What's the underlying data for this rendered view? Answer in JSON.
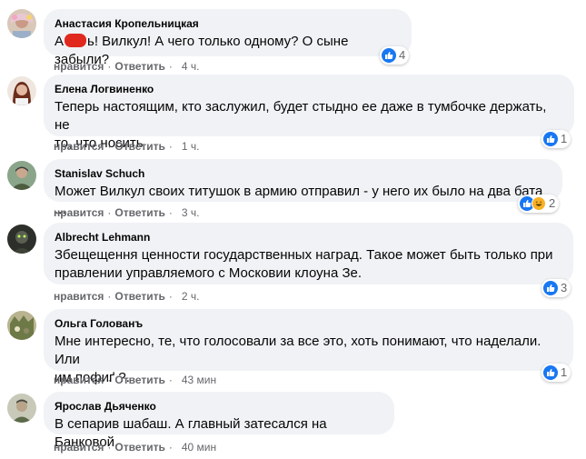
{
  "action_labels": {
    "like": "нравится",
    "reply": "Ответить",
    "separator": "·"
  },
  "comments": [
    {
      "author": "Анастасия Кропельницкая",
      "text_before": "А",
      "text_after": "ь! Вилкул! А чего только одному? О сыне забыли?",
      "time": "4 ч.",
      "reaction_count": "4",
      "reactions": [
        "like-icon"
      ]
    },
    {
      "author": "Елена Логвиненко",
      "lines": [
        "Теперь настоящим, кто заслужил, будет стыдно ее даже в тумбочке держать, не",
        "то, что носить"
      ],
      "time": "1 ч.",
      "reaction_count": "1",
      "reactions": [
        "like-icon"
      ]
    },
    {
      "author": "Stanislav Schuch",
      "lines": [
        "Может Вилкул своих титушок в армию отправил - у него их было на два бата ..."
      ],
      "time": "3 ч.",
      "reaction_count": "2",
      "reactions": [
        "like-icon",
        "haha-icon"
      ]
    },
    {
      "author": "Albrecht Lehmann",
      "lines": [
        "Збещещення ценности государственных наград. Такое может быть только при",
        "правлении управляемого с Московии клоуна Зе."
      ],
      "time": "2 ч.",
      "reaction_count": "3",
      "reactions": [
        "like-icon"
      ]
    },
    {
      "author": "Ольга Голованъ",
      "lines": [
        "Мне интересно, те, что голосовали за все это, хоть понимают, что наделали. Или",
        "им пофиґ ?."
      ],
      "time": "43 мин",
      "reaction_count": "1",
      "reactions": [
        "like-icon"
      ]
    },
    {
      "author": "Ярослав Дьяченко",
      "lines": [
        "В сепарив шабаш. А главный затесался на Банковой."
      ],
      "time": "40 мин",
      "reaction_count": "",
      "reactions": []
    }
  ]
}
